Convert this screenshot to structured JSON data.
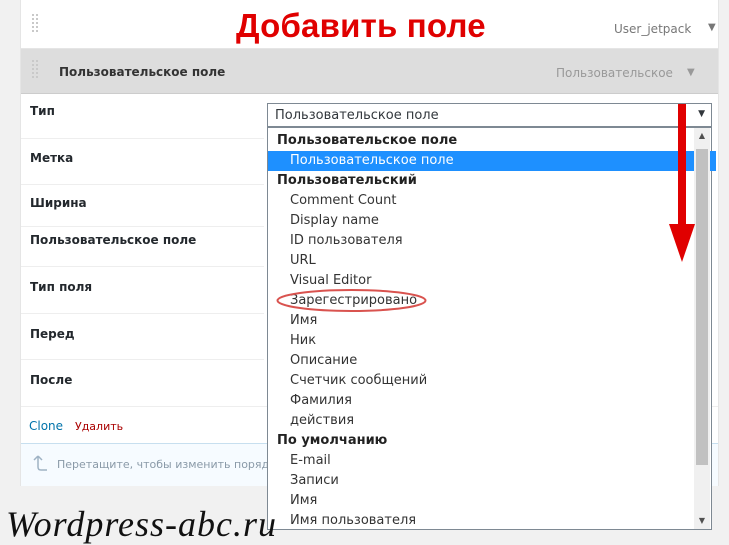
{
  "annotation": {
    "title": "Добавить поле",
    "arrow_color": "#e00000",
    "ring_color": "#d9534f",
    "watermark": "Wordpress-abc.ru"
  },
  "collapsed_widget": {
    "name": "User_jetpack",
    "arrow": "▼"
  },
  "expanded_widget": {
    "title": "Пользовательское поле",
    "type_hint": "Пользовательское",
    "arrow": "▼"
  },
  "fields": [
    {
      "label": "Тип"
    },
    {
      "label": "Метка"
    },
    {
      "label": "Ширина"
    },
    {
      "label": "Пользовательское поле"
    },
    {
      "label": "Тип поля"
    },
    {
      "label": "Перед"
    },
    {
      "label": "После"
    }
  ],
  "type_select": {
    "value": "Пользовательское поле",
    "caret": "▼",
    "selected_color": "#1e90ff",
    "highlighted_option": "Зарегестрировано",
    "options": [
      {
        "text": "Пользовательское поле",
        "kind": "group"
      },
      {
        "text": "Пользовательское поле",
        "kind": "option",
        "selected": true
      },
      {
        "text": "Пользовательский",
        "kind": "group"
      },
      {
        "text": "Comment Count",
        "kind": "option"
      },
      {
        "text": "Display name",
        "kind": "option"
      },
      {
        "text": "ID пользователя",
        "kind": "option"
      },
      {
        "text": "URL",
        "kind": "option"
      },
      {
        "text": "Visual Editor",
        "kind": "option"
      },
      {
        "text": "Зарегестрировано",
        "kind": "option"
      },
      {
        "text": "Имя",
        "kind": "option"
      },
      {
        "text": "Ник",
        "kind": "option"
      },
      {
        "text": "Описание",
        "kind": "option"
      },
      {
        "text": "Счетчик сообщений",
        "kind": "option"
      },
      {
        "text": "Фамилия",
        "kind": "option"
      },
      {
        "text": "действия",
        "kind": "option"
      },
      {
        "text": "По умолчанию",
        "kind": "group"
      },
      {
        "text": "E-mail",
        "kind": "option"
      },
      {
        "text": "Записи",
        "kind": "option"
      },
      {
        "text": "Имя",
        "kind": "option"
      },
      {
        "text": "Имя пользователя",
        "kind": "option"
      }
    ],
    "scroll_up": "▲",
    "scroll_down": "▼"
  },
  "actions": {
    "clone": "Clone",
    "delete": "Удалить"
  },
  "drag_hint": {
    "text": "Перетащите, чтобы изменить порядок"
  }
}
